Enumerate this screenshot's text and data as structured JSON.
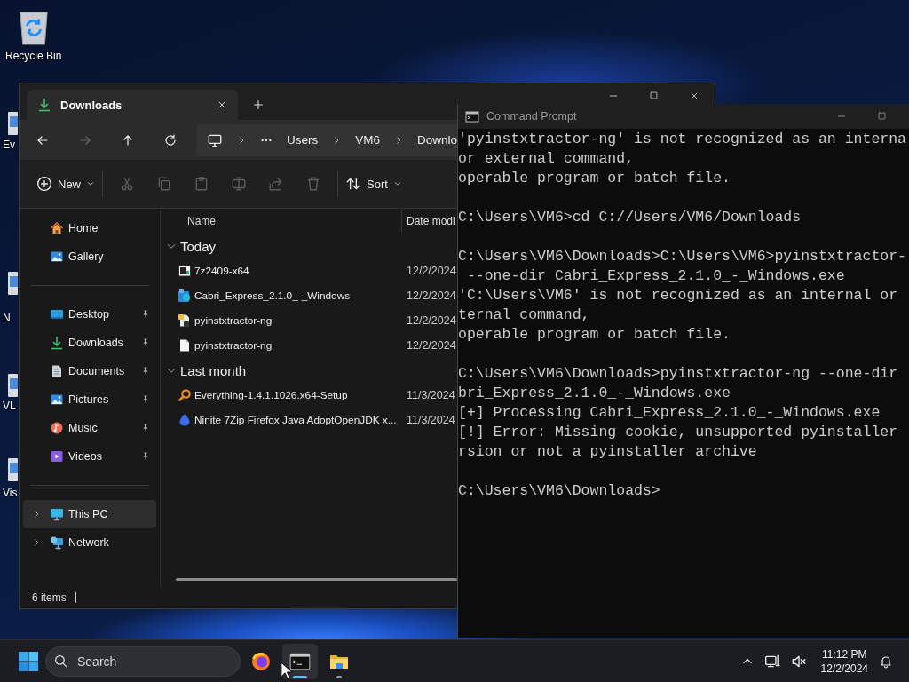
{
  "desktop": {
    "icons": [
      {
        "label": "Recycle Bin",
        "kind": "recycle"
      },
      {
        "label": "Ev",
        "kind": "app"
      },
      {
        "label": "N",
        "kind": "app"
      },
      {
        "label": "VL",
        "kind": "app"
      },
      {
        "label": "Vis",
        "kind": "app"
      }
    ]
  },
  "explorer": {
    "tabs": [
      {
        "title": "Downloads",
        "kind": "downloads",
        "selected": true
      }
    ],
    "nav": [
      {
        "kind": "back",
        "disabled": false
      },
      {
        "kind": "forward",
        "disabled": true
      },
      {
        "kind": "up",
        "disabled": false
      },
      {
        "kind": "refresh",
        "disabled": false
      }
    ],
    "breadcrumb": [
      "Users",
      "VM6",
      "Downlo"
    ],
    "toolbar": [
      {
        "kind": "new",
        "label": "New",
        "disabled": false
      },
      {
        "kind": "cut",
        "disabled": true
      },
      {
        "kind": "copy",
        "disabled": true
      },
      {
        "kind": "paste",
        "disabled": true
      },
      {
        "kind": "rename",
        "disabled": true
      },
      {
        "kind": "share",
        "disabled": true
      },
      {
        "kind": "delete",
        "disabled": true
      },
      {
        "kind": "sort",
        "label": "Sort",
        "disabled": false
      }
    ],
    "sidebar": {
      "sections": [
        {
          "items": [
            {
              "label": "Home",
              "kind": "home",
              "pinned": false,
              "selected": false,
              "expandable": false
            },
            {
              "label": "Gallery",
              "kind": "gallery",
              "pinned": false,
              "selected": false,
              "expandable": false
            }
          ]
        },
        {
          "items": [
            {
              "label": "Desktop",
              "kind": "desktop",
              "pinned": true,
              "selected": false,
              "expandable": false
            },
            {
              "label": "Downloads",
              "kind": "downloads",
              "pinned": true,
              "selected": false,
              "expandable": false
            },
            {
              "label": "Documents",
              "kind": "documents",
              "pinned": true,
              "selected": false,
              "expandable": false
            },
            {
              "label": "Pictures",
              "kind": "pictures",
              "pinned": true,
              "selected": false,
              "expandable": false
            },
            {
              "label": "Music",
              "kind": "music",
              "pinned": true,
              "selected": false,
              "expandable": false
            },
            {
              "label": "Videos",
              "kind": "videos",
              "pinned": true,
              "selected": false,
              "expandable": false
            }
          ]
        },
        {
          "items": [
            {
              "label": "This PC",
              "kind": "thispc",
              "pinned": false,
              "selected": true,
              "expandable": true
            },
            {
              "label": "Network",
              "kind": "network",
              "pinned": false,
              "selected": false,
              "expandable": true
            }
          ]
        }
      ]
    },
    "columns": [
      "Name",
      "Date modi"
    ],
    "groups": [
      {
        "label": "Today",
        "expanded": true,
        "rows": [
          {
            "name": "7z2409-x64",
            "date": "12/2/2024",
            "kind": "archive"
          },
          {
            "name": "Cabri_Express_2.1.0_-_Windows",
            "date": "12/2/2024",
            "kind": "installer"
          },
          {
            "name": "pyinstxtractor-ng",
            "date": "12/2/2024",
            "kind": "script"
          },
          {
            "name": "pyinstxtractor-ng",
            "date": "12/2/2024",
            "kind": "blank"
          }
        ]
      },
      {
        "label": "Last month",
        "expanded": true,
        "rows": [
          {
            "name": "Everything-1.4.1.1026.x64-Setup",
            "date": "11/3/2024",
            "kind": "magnifier"
          },
          {
            "name": "Ninite 7Zip Firefox Java AdoptOpenJDK x...",
            "date": "11/3/2024",
            "kind": "drop"
          }
        ]
      }
    ],
    "status_bar": {
      "item_count": "6 items"
    }
  },
  "cmd": {
    "title": "Command Prompt",
    "blocks": [
      [
        "'pyinstxtractor-ng' is not recognized as an interna",
        "or external command,",
        "operable program or batch file."
      ],
      [
        "C:\\Users\\VM6>cd C://Users/VM6/Downloads"
      ],
      [
        "C:\\Users\\VM6\\Downloads>C:\\Users\\VM6>pyinstxtractor-",
        " --one-dir Cabri_Express_2.1.0_-_Windows.exe",
        "'C:\\Users\\VM6' is not recognized as an internal or",
        "ternal command,",
        "operable program or batch file."
      ],
      [
        "C:\\Users\\VM6\\Downloads>pyinstxtractor-ng --one-dir",
        "bri_Express_2.1.0_-_Windows.exe",
        "[+] Processing Cabri_Express_2.1.0_-_Windows.exe",
        "[!] Error: Missing cookie, unsupported pyinstaller",
        "rsion or not a pyinstaller archive"
      ],
      [
        "C:\\Users\\VM6\\Downloads>"
      ]
    ]
  },
  "taskbar": {
    "search": {
      "placeholder": "Search"
    },
    "apps": [
      {
        "kind": "firefox",
        "active": false,
        "running": false
      },
      {
        "kind": "terminal",
        "active": true,
        "running": true
      },
      {
        "kind": "folder",
        "active": false,
        "running": true
      }
    ],
    "clock": {
      "time": "11:12 PM",
      "date": "12/2/2024"
    }
  }
}
